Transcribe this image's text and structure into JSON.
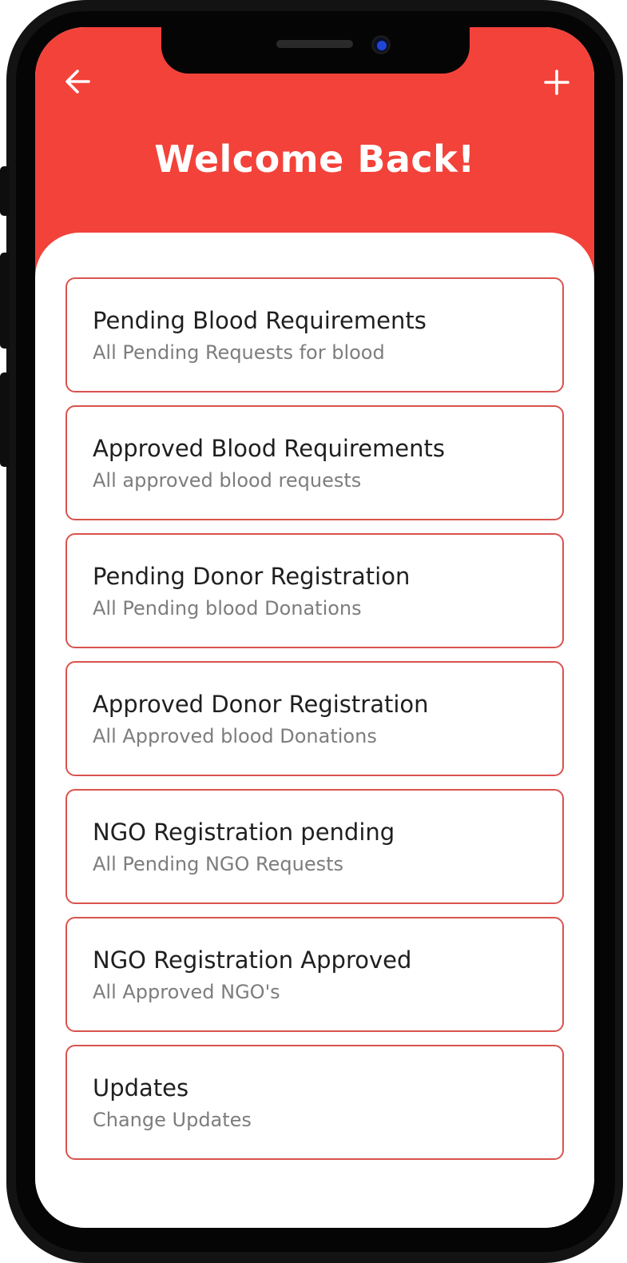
{
  "header": {
    "title": "Welcome Back!",
    "back_icon": "arrow-left-icon",
    "add_icon": "plus-icon",
    "accent_color": "#f3423a"
  },
  "menu": {
    "items": [
      {
        "title": "Pending Blood Requirements",
        "subtitle": "All Pending Requests for blood"
      },
      {
        "title": "Approved Blood Requirements",
        "subtitle": "All approved blood requests"
      },
      {
        "title": "Pending Donor Registration",
        "subtitle": "All Pending blood Donations"
      },
      {
        "title": "Approved Donor Registration",
        "subtitle": "All Approved blood Donations"
      },
      {
        "title": "NGO Registration pending",
        "subtitle": "All Pending NGO Requests"
      },
      {
        "title": "NGO Registration Approved",
        "subtitle": "All Approved NGO's"
      },
      {
        "title": "Updates",
        "subtitle": "Change Updates"
      }
    ],
    "border_color": "#d9534e"
  }
}
